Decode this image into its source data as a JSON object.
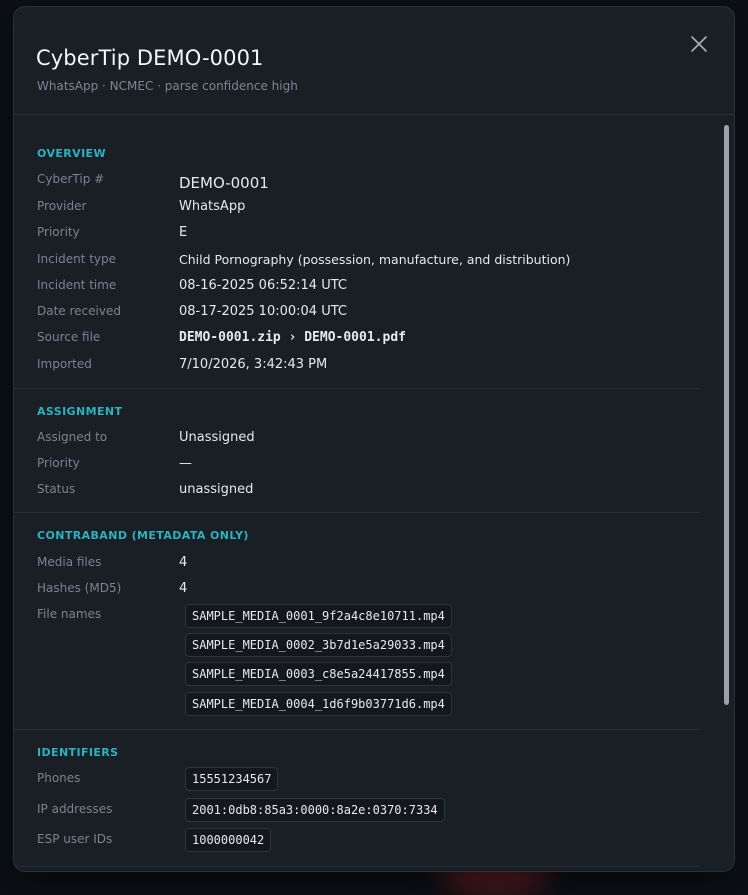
{
  "header": {
    "title": "CyberTip DEMO-0001",
    "subtitle": "WhatsApp · NCMEC · parse confidence high",
    "close_icon": "close-icon"
  },
  "overview": {
    "heading": "OVERVIEW",
    "rows": [
      {
        "label": "CyberTip #",
        "value": "DEMO-0001"
      },
      {
        "label": "Provider",
        "value": "WhatsApp"
      },
      {
        "label": "Priority",
        "value": "E"
      },
      {
        "label": "Incident type",
        "value": "Child Pornography (possession, manufacture, and distribution)"
      },
      {
        "label": "Incident time",
        "value": "08-16-2025 06:52:14 UTC"
      },
      {
        "label": "Date received",
        "value": "08-17-2025 10:00:04 UTC"
      },
      {
        "label": "Source file",
        "value": "DEMO-0001.zip › DEMO-0001.pdf"
      },
      {
        "label": "Imported",
        "value": "7/10/2026, 3:42:43 PM"
      }
    ]
  },
  "assignment": {
    "heading": "ASSIGNMENT",
    "rows": [
      {
        "label": "Assigned to",
        "value": "Unassigned"
      },
      {
        "label": "Priority",
        "value": "—"
      },
      {
        "label": "Status",
        "value": "unassigned"
      }
    ]
  },
  "contraband": {
    "heading": "CONTRABAND (METADATA ONLY)",
    "media_label": "Media files",
    "media_value": "4",
    "hashes_label": "Hashes (MD5)",
    "hashes_value": "4",
    "files_label": "File names",
    "files": [
      "SAMPLE_MEDIA_0001_9f2a4c8e10711.mp4",
      "SAMPLE_MEDIA_0002_3b7d1e5a29033.mp4",
      "SAMPLE_MEDIA_0003_c8e5a24417855.mp4",
      "SAMPLE_MEDIA_0004_1d6f9b03771d6.mp4"
    ]
  },
  "identifiers": {
    "heading": "IDENTIFIERS",
    "phones_label": "Phones",
    "phones_value": "15551234567",
    "ip_label": "IP addresses",
    "ip_value": "2001:0db8:85a3:0000:8a2e:0370:7334",
    "esp_label": "ESP user IDs",
    "esp_value": "1000000042"
  },
  "colors": {
    "accent": "#2cb3c0",
    "background": "#1a1e25",
    "muted_text": "#7a8390"
  }
}
